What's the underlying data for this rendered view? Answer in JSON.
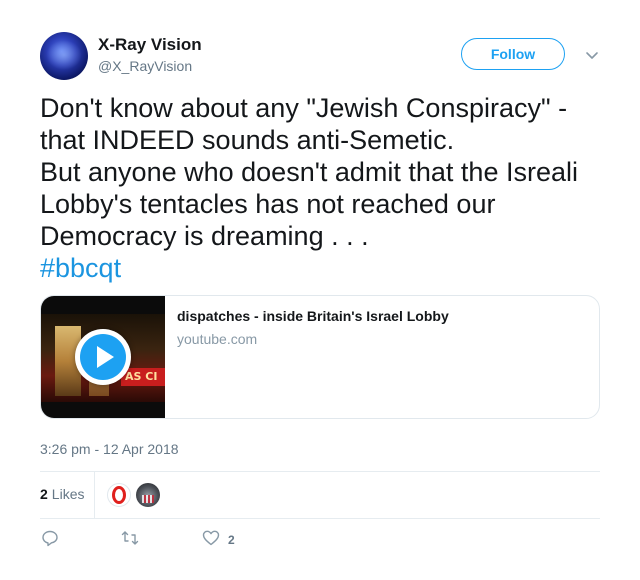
{
  "user": {
    "display_name": "X-Ray Vision",
    "handle": "@X_RayVision"
  },
  "follow_button": {
    "label": "Follow"
  },
  "tweet": {
    "lines": [
      "Don't know about any \"Jewish Conspiracy\" -",
      "that INDEED sounds anti-Semetic.",
      "But anyone who doesn't admit that the Isreali",
      "Lobby's tentacles has not reached our",
      "Democracy is dreaming . . ."
    ],
    "hashtag": "#bbcqt"
  },
  "card": {
    "title": "dispatches - inside Britain's Israel Lobby",
    "domain": "youtube.com",
    "thumbnail_sign_text": "AS CI"
  },
  "timestamp": "3:26 pm - 12 Apr 2018",
  "likes": {
    "count": "2",
    "label": "Likes"
  },
  "actions": {
    "reply_icon": "reply-icon",
    "retweet_icon": "retweet-icon",
    "like_icon": "heart-icon",
    "like_count": "2"
  },
  "colors": {
    "accent": "#1da1f2",
    "hashtag": "#1b95e0",
    "secondary_text": "#657786",
    "border": "#e1e8ed"
  }
}
